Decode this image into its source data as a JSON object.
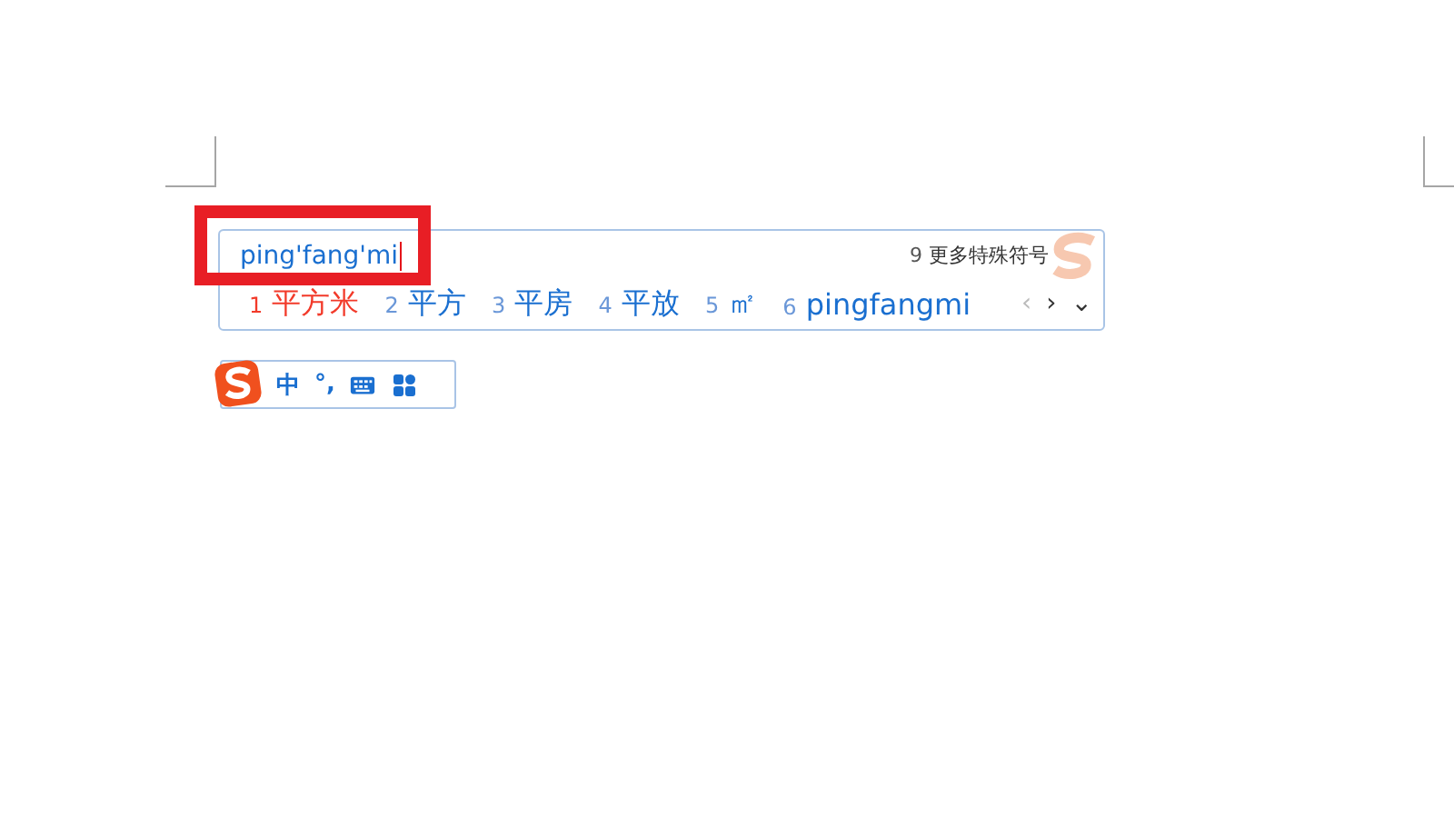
{
  "ime": {
    "composition": "ping'fang'mi",
    "more_symbols": {
      "number": "9",
      "label": "更多特殊符号"
    },
    "candidates": [
      {
        "number": "1",
        "text": "平方米",
        "selected": true
      },
      {
        "number": "2",
        "text": "平方",
        "selected": false
      },
      {
        "number": "3",
        "text": "平房",
        "selected": false
      },
      {
        "number": "4",
        "text": "平放",
        "selected": false
      },
      {
        "number": "5",
        "text": "㎡",
        "selected": false
      },
      {
        "number": "6",
        "text": "pingfangmi",
        "selected": false
      }
    ],
    "composition_highlighted": true,
    "prev_page": "‹",
    "next_page": "›",
    "expand": "⌄"
  },
  "status_bar": {
    "mode": "中",
    "punctuation": "°,"
  }
}
